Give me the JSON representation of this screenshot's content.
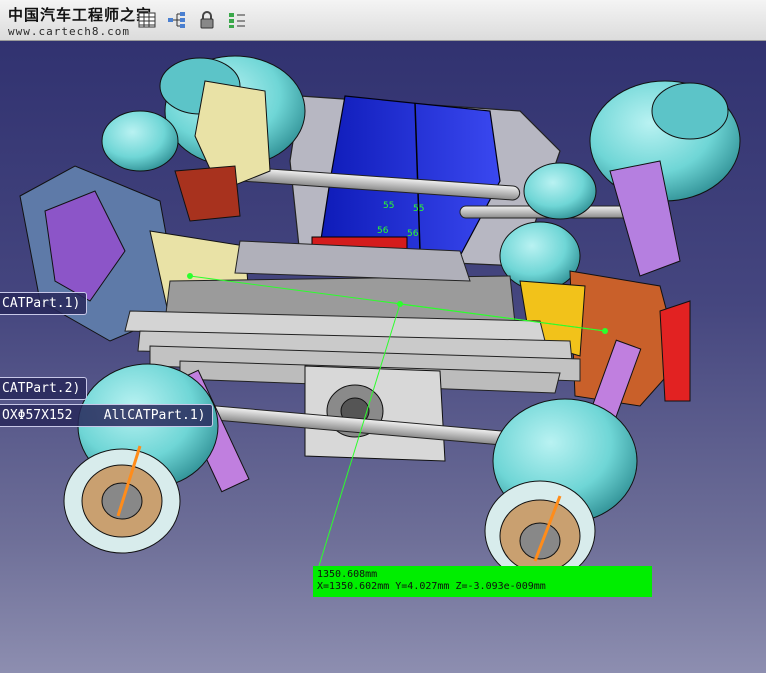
{
  "watermark": {
    "title": "中国汽车工程师之家",
    "url": "www.cartech8.com"
  },
  "toolbar": {
    "icons": [
      "grid-table-icon",
      "tree-structure-icon",
      "padlock-icon",
      "list-toggle-icon"
    ]
  },
  "labels": [
    {
      "text": "CATPart.1)"
    },
    {
      "text": "CATPart.2)"
    },
    {
      "text": "OXΦ57X152    AllCATPart.1)"
    }
  ],
  "measurement": {
    "distance": "1350.608mm",
    "coordinates": "X=1350.602mm  Y=4.027mm  Z=-3.093e-009mm"
  },
  "tags": [
    "55",
    "55",
    "56",
    "56"
  ],
  "colors": {
    "background_top": "#2e2f6e",
    "measure_green": "#00ee00",
    "hub_cyan": "#6fd6d6",
    "frame_blue": "#1a2bd6",
    "spring_gray": "#c9c9c9"
  }
}
